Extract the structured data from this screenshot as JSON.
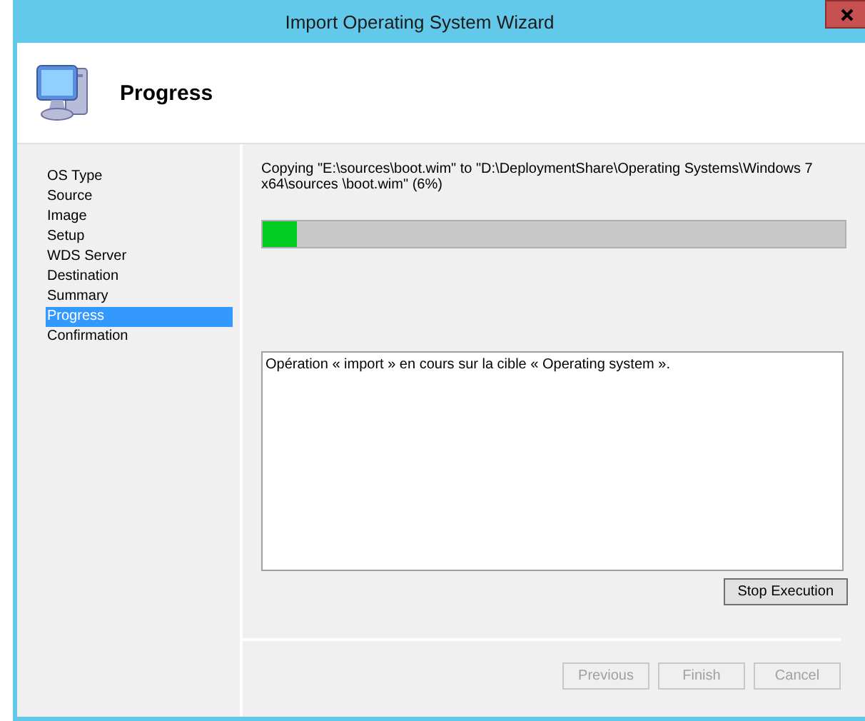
{
  "window": {
    "title": "Import Operating System Wizard"
  },
  "header": {
    "title": "Progress"
  },
  "sidebar": {
    "items": [
      {
        "label": "OS Type",
        "selected": false
      },
      {
        "label": "Source",
        "selected": false
      },
      {
        "label": "Image",
        "selected": false
      },
      {
        "label": "Setup",
        "selected": false
      },
      {
        "label": "WDS Server",
        "selected": false
      },
      {
        "label": "Destination",
        "selected": false
      },
      {
        "label": "Summary",
        "selected": false
      },
      {
        "label": "Progress",
        "selected": true
      },
      {
        "label": "Confirmation",
        "selected": false
      }
    ]
  },
  "progress": {
    "status": "Copying \"E:\\sources\\boot.wim\" to \"D:\\DeploymentShare\\Operating Systems\\Windows 7 x64\\sources \\boot.wim\" (6%)",
    "level": 0.06
  },
  "log": {
    "value": "Opération « import » en cours sur la cible « Operating system »."
  },
  "stop_button": {
    "label": "Stop Execution",
    "disabled": false
  },
  "buttons": [
    {
      "label": "Previous",
      "disabled": true
    },
    {
      "label": "Finish",
      "disabled": true
    },
    {
      "label": "Cancel",
      "disabled": true
    }
  ]
}
